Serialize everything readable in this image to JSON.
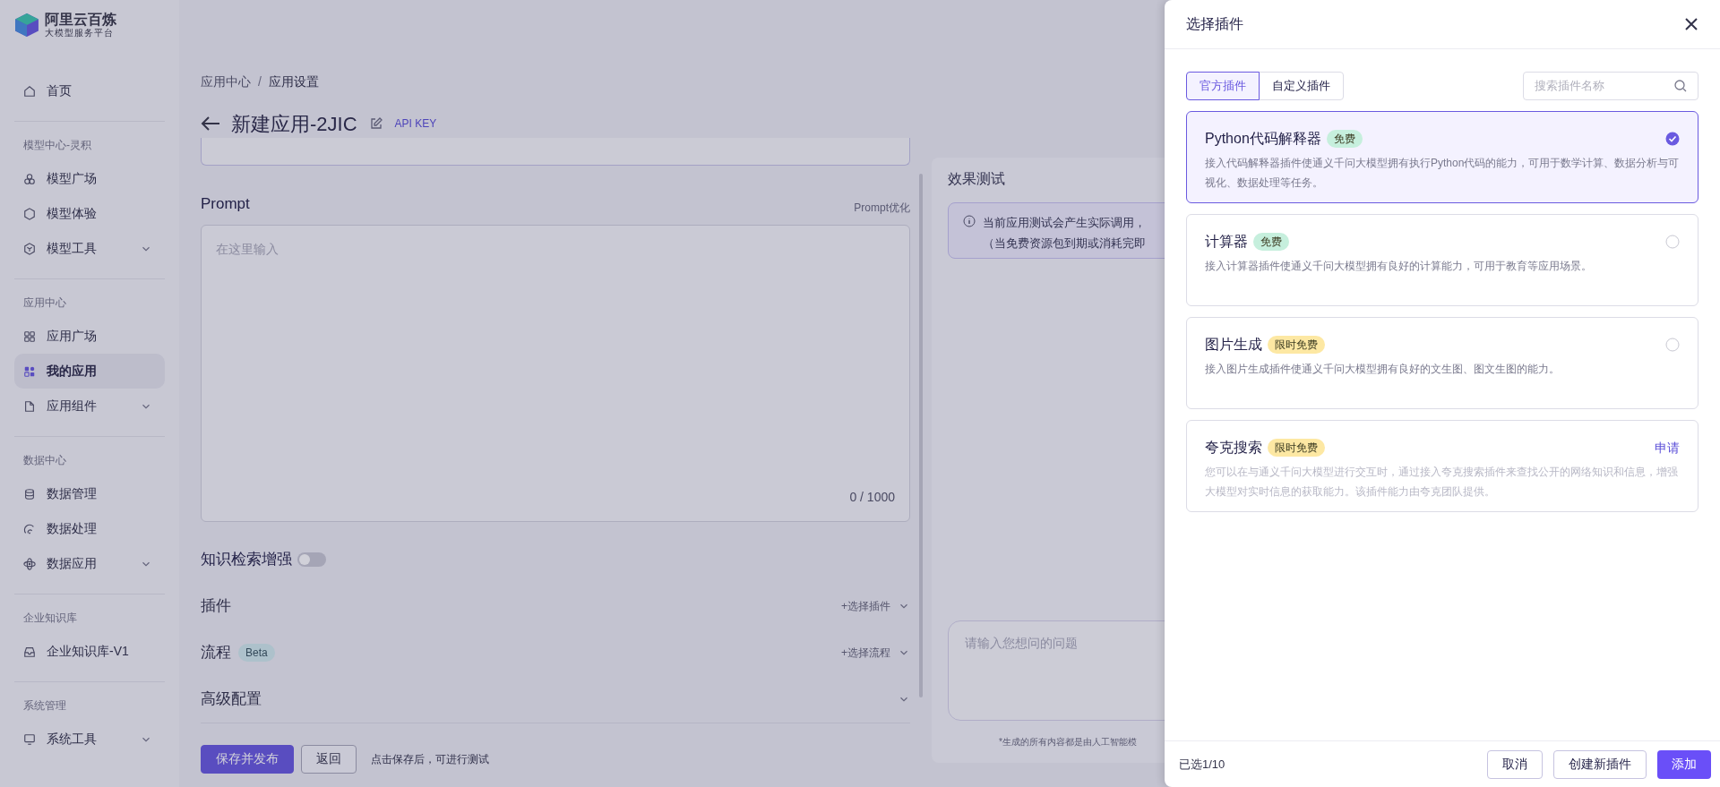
{
  "logo": {
    "title": "阿里云百炼",
    "subtitle": "大模型服务平台"
  },
  "sidebar": {
    "sections": [
      {
        "items": [
          {
            "label": "首页",
            "selected": false,
            "has_submenu": false
          }
        ]
      },
      {
        "heading": "模型中心-灵积",
        "items": [
          {
            "label": "模型广场",
            "selected": false,
            "has_submenu": false
          },
          {
            "label": "模型体验",
            "selected": false,
            "has_submenu": false
          },
          {
            "label": "模型工具",
            "selected": false,
            "has_submenu": true
          }
        ]
      },
      {
        "heading": "应用中心",
        "items": [
          {
            "label": "应用广场",
            "selected": false,
            "has_submenu": false
          },
          {
            "label": "我的应用",
            "selected": true,
            "has_submenu": false
          },
          {
            "label": "应用组件",
            "selected": false,
            "has_submenu": true
          }
        ]
      },
      {
        "heading": "数据中心",
        "items": [
          {
            "label": "数据管理",
            "selected": false,
            "has_submenu": false
          },
          {
            "label": "数据处理",
            "selected": false,
            "has_submenu": false
          },
          {
            "label": "数据应用",
            "selected": false,
            "has_submenu": true
          }
        ]
      },
      {
        "heading": "企业知识库",
        "items": [
          {
            "label": "企业知识库-V1",
            "selected": false,
            "has_submenu": false
          }
        ]
      },
      {
        "heading": "系统管理",
        "items": [
          {
            "label": "系统工具",
            "selected": false,
            "has_submenu": true
          }
        ]
      }
    ]
  },
  "breadcrumb": [
    "应用中心",
    "应用设置"
  ],
  "breadcrumb_separator": "/",
  "page_title": "新建应用-2JIC",
  "api_key_link": "API KEY",
  "prompt": {
    "label": "Prompt",
    "optimize_link": "Prompt优化",
    "placeholder": "在这里输入",
    "counter": "0 / 1000"
  },
  "knowledge_toggle": {
    "label": "知识检索增强",
    "on": false
  },
  "sections": [
    {
      "label": "插件",
      "action": "+选择插件"
    },
    {
      "label": "流程",
      "badge": "Beta",
      "action": "+选择流程"
    },
    {
      "label": "高级配置"
    }
  ],
  "footer_buttons": [
    {
      "label": "保存并发布",
      "kind": "primary"
    },
    {
      "label": "返回",
      "kind": "default"
    }
  ],
  "footer_hint": "点击保存后，可进行测试",
  "test_panel": {
    "title": "效果测试",
    "notice": [
      "当前应用测试会产生实际调用，",
      "（当免费资源包到期或消耗完即"
    ],
    "question_placeholder": "请输入您想问的问题",
    "disclaimer": "*生成的所有内容都是由人工智能模"
  },
  "drawer": {
    "title": "选择插件",
    "tabs": [
      {
        "label": "官方插件",
        "selected": true
      },
      {
        "label": "自定义插件",
        "selected": false
      }
    ],
    "search": {
      "placeholder": "搜索插件名称"
    },
    "plugins": [
      {
        "kind": "selectable",
        "name": "Python代码解释器",
        "badge": "免费",
        "color": "#c6efdd",
        "selected": true,
        "description": "接入代码解释器插件使通义千问大模型拥有执行Python代码的能力，可用于数学计算、数据分析与可视化、数据处理等任务。"
      },
      {
        "kind": "selectable",
        "name": "计算器",
        "badge": "免费",
        "color": "#c6efdd",
        "selected": false,
        "description": "接入计算器插件使通义千问大模型拥有良好的计算能力，可用于教育等应用场景。"
      },
      {
        "kind": "selectable",
        "name": "图片生成",
        "badge": "限时免费",
        "color": "#fde8a3",
        "selected": false,
        "description": "接入图片生成插件使通义千问大模型拥有良好的文生图、图文生图的能力。"
      },
      {
        "kind": "apply",
        "name": "夸克搜索",
        "badge": "限时免费",
        "color": "#fde8a3",
        "action": "申请",
        "description": "您可以在与通义千问大模型进行交互时，通过接入夸克搜索插件来查找公开的网络知识和信息，增强大模型对实时信息的获取能力。该插件能力由夸克团队提供。"
      }
    ],
    "selected_count": "已选1/10",
    "buttons": [
      {
        "label": "取消",
        "kind": "default"
      },
      {
        "label": "创建新插件",
        "kind": "default"
      },
      {
        "label": "添加",
        "kind": "primary"
      }
    ]
  }
}
